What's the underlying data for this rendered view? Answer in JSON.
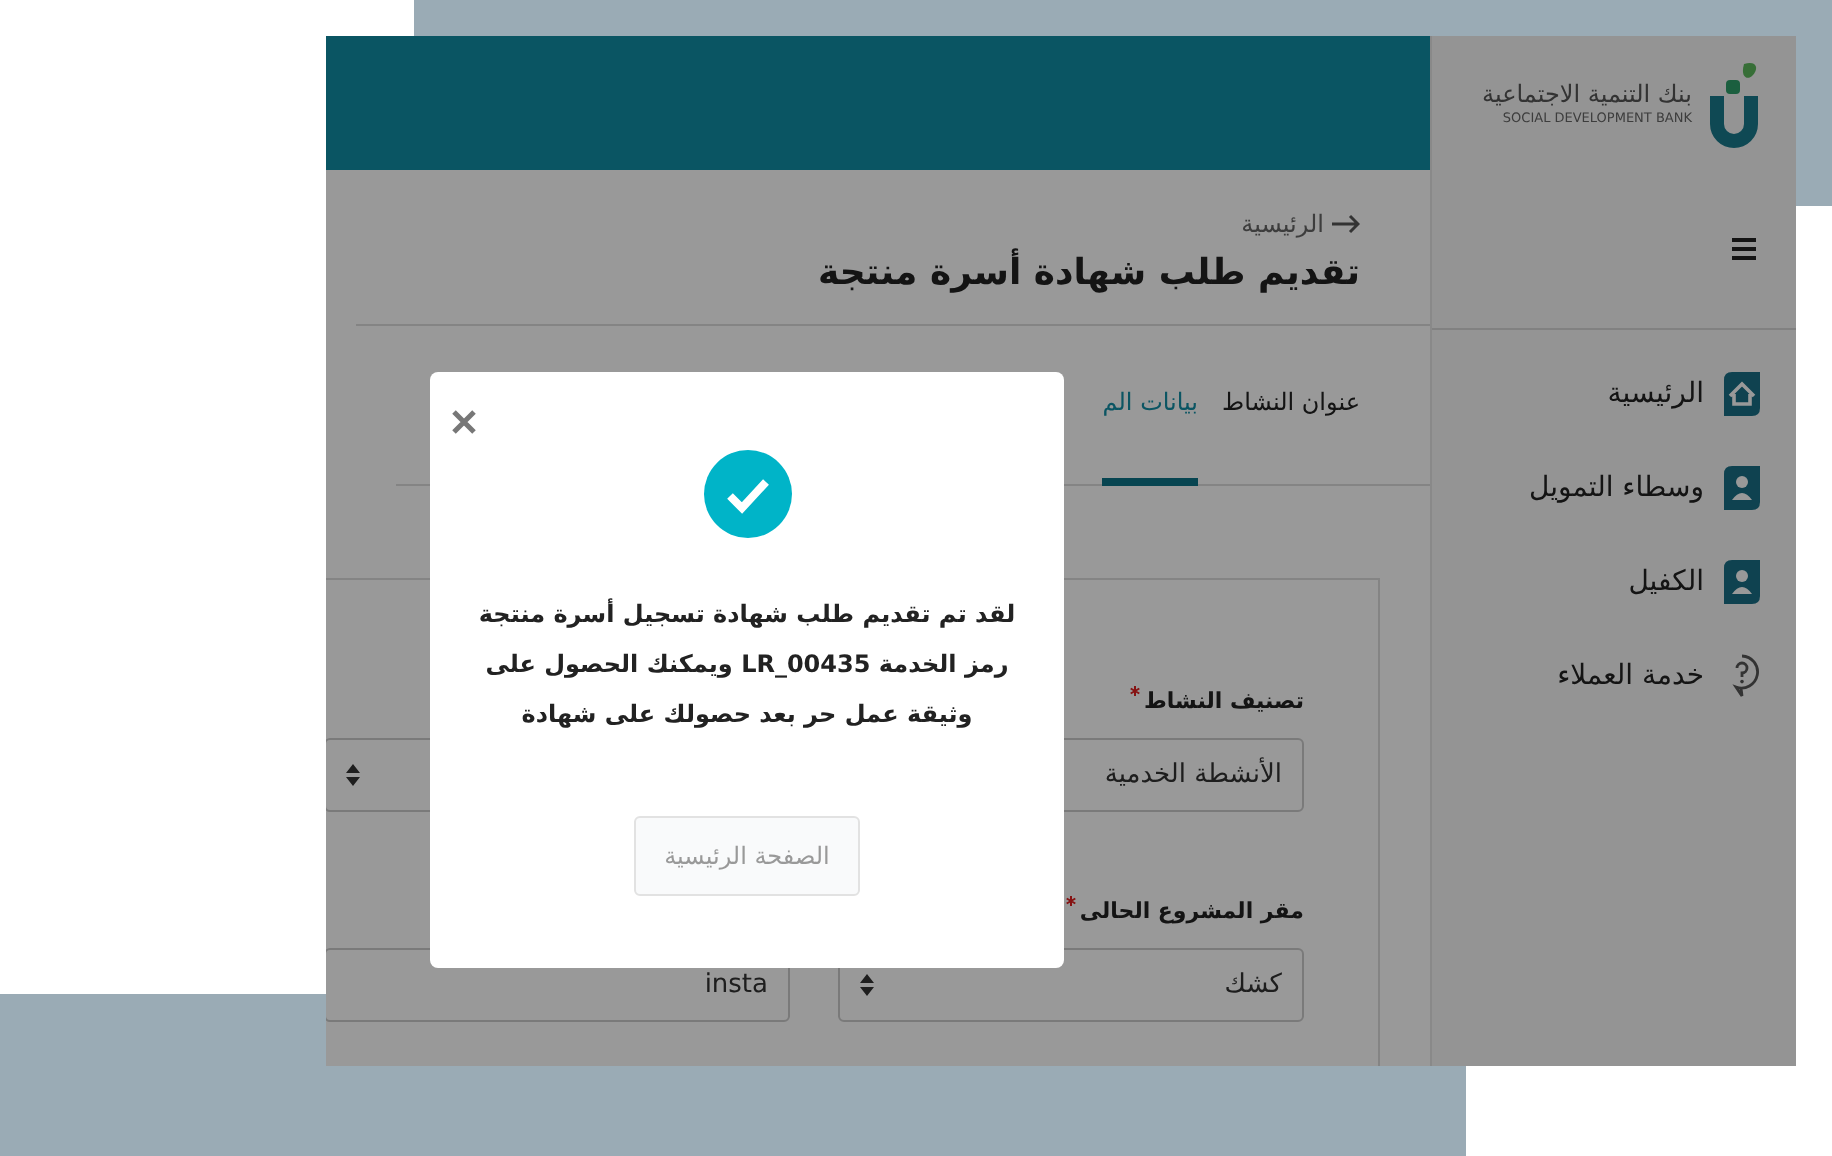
{
  "logo": {
    "arabic": "بنك التنمية الاجتماعية",
    "english": "SOCIAL DEVELOPMENT BANK"
  },
  "sidebar": {
    "items": [
      {
        "label": "الرئيسية",
        "kind": "home"
      },
      {
        "label": "وسطاء التمويل",
        "kind": "person"
      },
      {
        "label": "الكفيل",
        "kind": "person"
      },
      {
        "label": "خدمة العملاء",
        "kind": "help"
      }
    ]
  },
  "breadcrumb": "الرئيسية",
  "page_title": "تقديم طلب شهادة أسرة منتجة",
  "tabs": [
    {
      "label": "عنوان النشاط",
      "selected": false
    },
    {
      "label": "بيانات الم",
      "selected": true
    }
  ],
  "form": {
    "fields": [
      {
        "kind": "select",
        "label": "تصنيف النشاط",
        "required": true,
        "value": "الأنشطة الخدمية"
      },
      {
        "kind": "select"
      },
      {
        "kind": "select",
        "label": "مقر المشروع الحالى",
        "required": true,
        "value": "كشك"
      },
      {
        "kind": "text",
        "value": "insta"
      }
    ]
  },
  "modal": {
    "message": "لقد تم تقديم طلب شهادة تسجيل أسرة منتجة رمز الخدمة LR_00435 ويمكنك الحصول على وثيقة عمل حر بعد حصولك على شهادة",
    "button": "الصفحة الرئيسية"
  }
}
